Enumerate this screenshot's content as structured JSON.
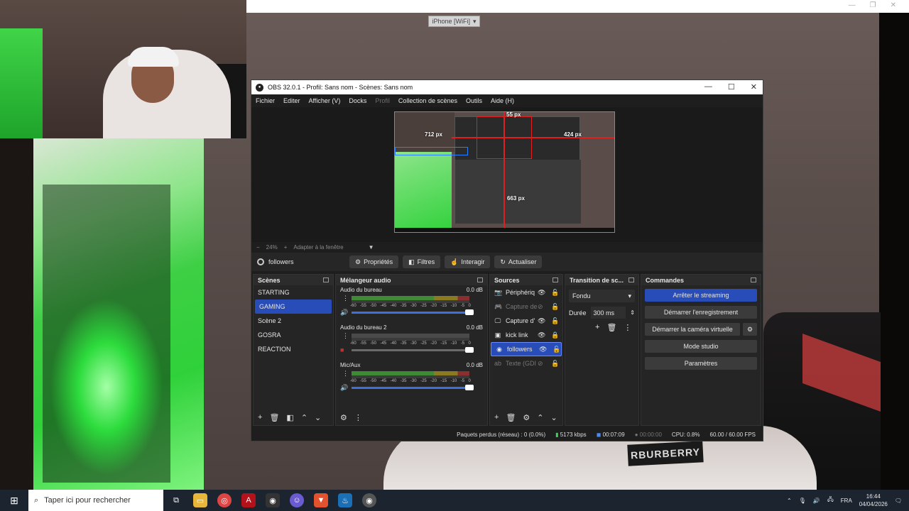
{
  "top_chip": "iPhone [WiFi]",
  "obs": {
    "title": "OBS 32.0.1 - Profil: Sans nom - Scènes: Sans nom",
    "menu": [
      "Fichier",
      "Editer",
      "Afficher (V)",
      "Docks",
      "Profil",
      "Collection de scènes",
      "Outils",
      "Aide (H)"
    ],
    "preview_labels": {
      "a": "55 px",
      "b": "712 px",
      "c": "424 px",
      "d": "663 px"
    },
    "zoom": {
      "minus": "−",
      "value": "24%",
      "plus": "+",
      "fit": "Adapter à la fenêtre"
    },
    "selected_source": "followers",
    "toolbar": {
      "properties": "Propriétés",
      "filters": "Filtres",
      "interact": "Interagir",
      "refresh": "Actualiser"
    },
    "scenes": {
      "title": "Scènes",
      "items": [
        "STARTING",
        "GAMING",
        "Scène 2",
        "GOSRA",
        "REACTION"
      ],
      "active_index": 1
    },
    "mixer": {
      "title": "Mélangeur audio",
      "channels": [
        {
          "name": "Audio du bureau",
          "db": "0.0 dB"
        },
        {
          "name": "Audio du bureau 2",
          "db": "0.0 dB"
        },
        {
          "name": "Mic/Aux",
          "db": "0.0 dB"
        }
      ],
      "ticks": [
        "-60",
        "-55",
        "-50",
        "-45",
        "-40",
        "-35",
        "-30",
        "-25",
        "-20",
        "-15",
        "-10",
        "-5",
        "0"
      ]
    },
    "sources": {
      "title": "Sources",
      "items": [
        {
          "name": "Périphériq",
          "icon": "camera-icon"
        },
        {
          "name": "Capture de",
          "icon": "gamepad-icon"
        },
        {
          "name": "Capture d'",
          "icon": "monitor-icon"
        },
        {
          "name": "kick link",
          "icon": "image-icon"
        },
        {
          "name": "followers",
          "icon": "globe-icon"
        },
        {
          "name": "Texte (GDI",
          "icon": "text-icon"
        }
      ]
    },
    "transitions": {
      "title": "Transition de sc...",
      "type": "Fondu",
      "duration_label": "Durée",
      "duration": "300 ms"
    },
    "controls": {
      "title": "Commandes",
      "stop_stream": "Arrêter le streaming",
      "start_record": "Démarrer l'enregistrement",
      "virtual_cam": "Démarrer la caméra virtuelle",
      "studio_mode": "Mode studio",
      "settings": "Paramètres"
    },
    "status": {
      "dropped": "Paquets perdus (réseau) : 0 (0.0%)",
      "bitrate": "5173 kbps",
      "stream_time": "00:07:09",
      "rec_time": "00:00:00",
      "cpu": "CPU: 0.8%",
      "fps": "60.00 / 60.00 FPS"
    }
  },
  "taskbar": {
    "search_placeholder": "Taper ici pour rechercher",
    "lang": "FRA",
    "time": "16:44",
    "date": "04/04/2026"
  },
  "bg_logo": "RBURBERRY"
}
